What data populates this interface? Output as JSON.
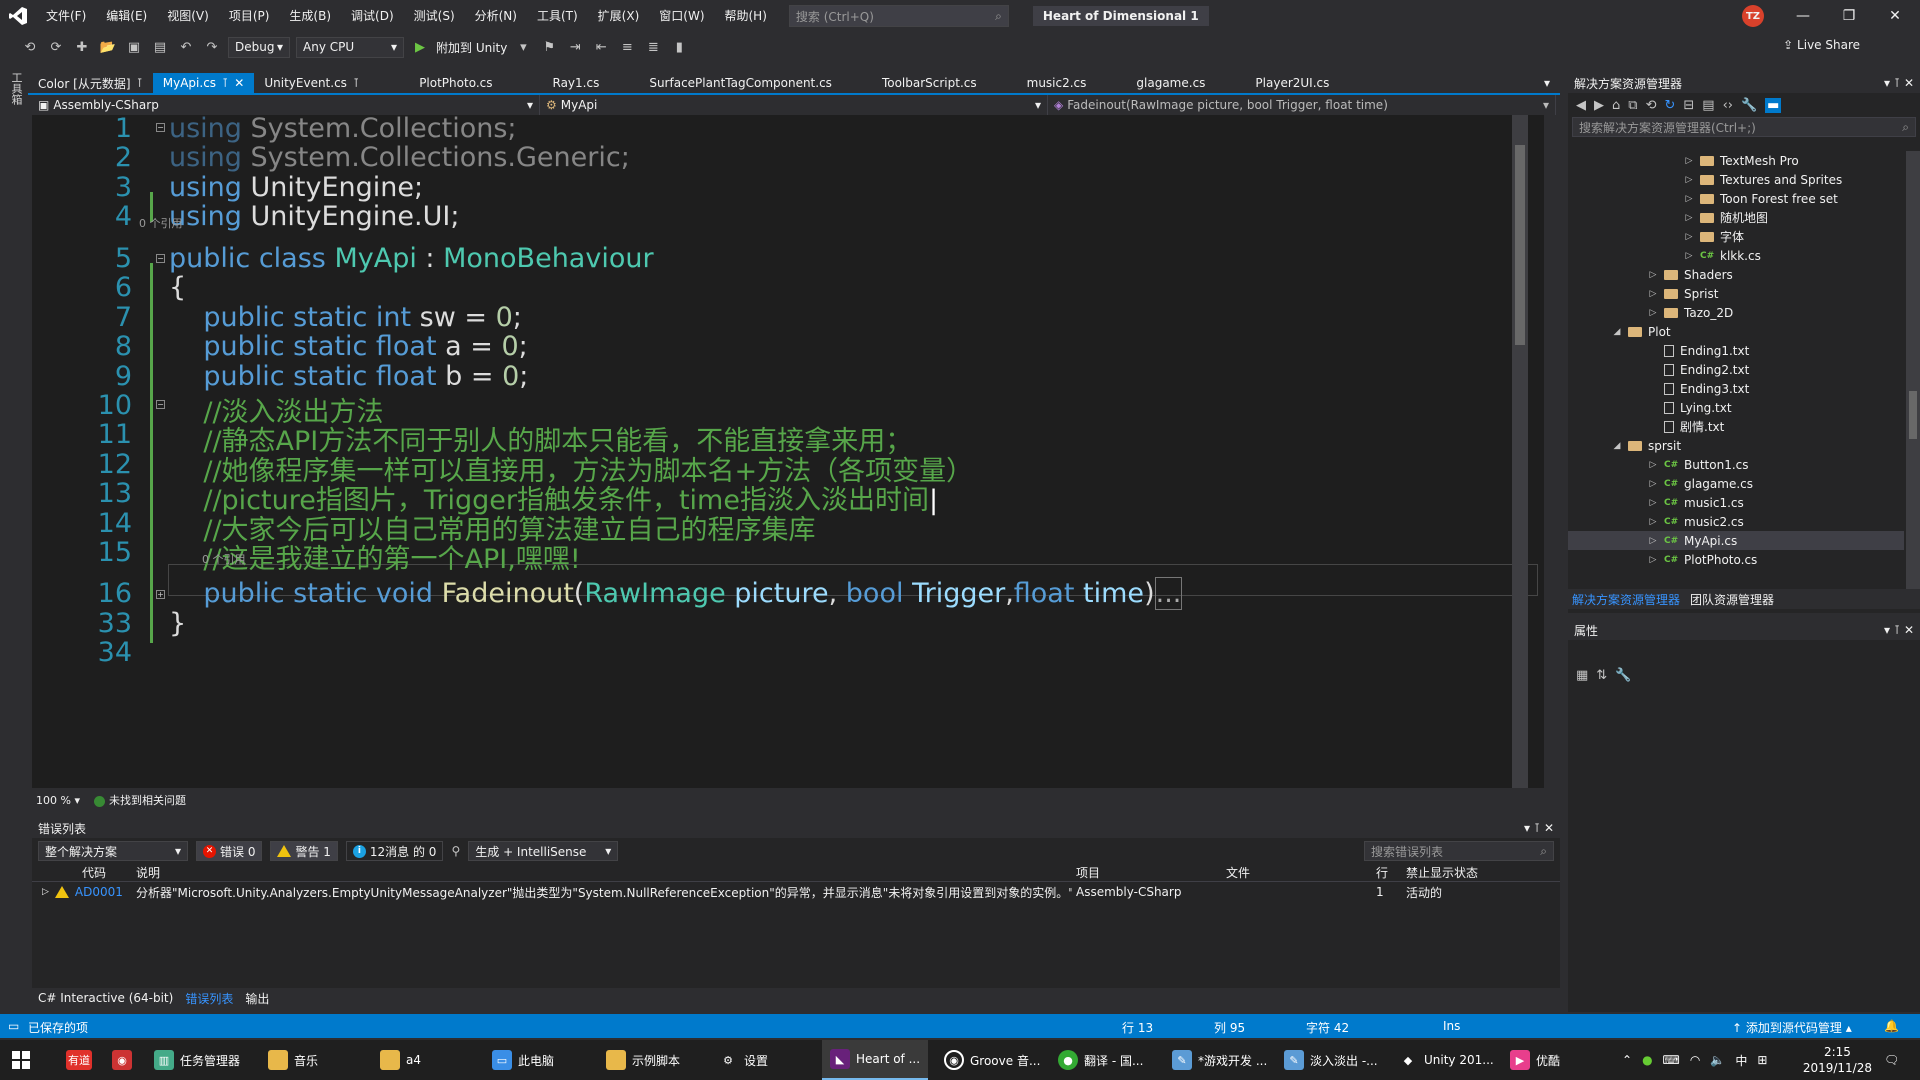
{
  "menu": [
    "文件(F)",
    "编辑(E)",
    "视图(V)",
    "项目(P)",
    "生成(B)",
    "调试(D)",
    "测试(S)",
    "分析(N)",
    "工具(T)",
    "扩展(X)",
    "窗口(W)",
    "帮助(H)"
  ],
  "quick_search_placeholder": "搜索 (Ctrl+Q)",
  "solution_name": "Heart of Dimensional 1",
  "user_initials": "TZ",
  "toolbar": {
    "config": "Debug",
    "platform": "Any CPU",
    "attach": "附加到 Unity",
    "live_share": "Live Share"
  },
  "toolbox_label": "工具箱",
  "tabs": [
    "Color [从元数据]",
    "MyApi.cs",
    "UnityEvent.cs",
    "PlotPhoto.cs",
    "Ray1.cs",
    "SurfacePlantTagComponent.cs",
    "ToolbarScript.cs",
    "music2.cs",
    "glagame.cs",
    "Player2UI.cs"
  ],
  "active_tab": "MyApi.cs",
  "nav": {
    "project": "Assembly-CSharp",
    "class": "MyApi",
    "member": "Fadeinout(RawImage picture, bool Trigger, float time)"
  },
  "code": {
    "line_numbers": [
      "1",
      "2",
      "3",
      "4",
      "5",
      "6",
      "7",
      "8",
      "9",
      "10",
      "11",
      "12",
      "13",
      "14",
      "15",
      "16",
      "33",
      "34"
    ],
    "ref_hint": "0 个引用",
    "l1_ns": "System.Collections;",
    "l2_ns": "System.Collections.Generic;",
    "l3_ns": "UnityEngine;",
    "l4_ns": "UnityEngine.UI;",
    "using_kw": "using",
    "class_decl": "public class",
    "class_name": "MyApi",
    "base_class": "MonoBehaviour",
    "c10": "//淡入淡出方法",
    "c11": "//静态API方法不同于别人的脚本只能看，不能直接拿来用；",
    "c12": "//她像程序集一样可以直接用，方法为脚本名+方法（各项变量）",
    "c13": "//picture指图片，Trigger指触发条件，time指淡入淡出时间",
    "c14": "//大家今后可以自己常用的算法建立自己的程序集库",
    "c15": "//这是我建立的第一个API,嘿嘿!",
    "method_name": "Fadeinout",
    "param_type1": "RawImage",
    "param1": "picture",
    "param_type2": "bool",
    "param2": "Trigger",
    "param_type3": "float",
    "param3": "time"
  },
  "editor_status": {
    "zoom": "100 %",
    "issues": "未找到相关问题"
  },
  "error_list": {
    "title": "错误列表",
    "scope": "整个解决方案",
    "errors": "错误 0",
    "warnings": "警告 1",
    "messages": "12消息 的 0",
    "build_filter": "生成 + IntelliSense",
    "search_placeholder": "搜索错误列表",
    "columns": [
      "代码",
      "说明",
      "项目",
      "文件",
      "行",
      "禁止显示状态"
    ],
    "rows": [
      {
        "code": "AD0001",
        "desc": "分析器\"Microsoft.Unity.Analyzers.EmptyUnityMessageAnalyzer\"抛出类型为\"System.NullReferenceException\"的异常，并显示消息\"未将对象引用设置到对象的实例。\"。",
        "project": "Assembly-CSharp",
        "file": "",
        "line": "1",
        "state": "活动的"
      }
    ]
  },
  "bottom_tabs": [
    "C# Interactive (64-bit)",
    "错误列表",
    "输出"
  ],
  "solution_explorer": {
    "title": "解决方案资源管理器",
    "search_placeholder": "搜索解决方案资源管理器(Ctrl+;)",
    "items": [
      {
        "label": "TextMesh Pro",
        "kind": "folder",
        "depth": 3
      },
      {
        "label": "Textures and Sprites",
        "kind": "folder",
        "depth": 3
      },
      {
        "label": "Toon Forest free set",
        "kind": "folder",
        "depth": 3
      },
      {
        "label": "随机地图",
        "kind": "folder",
        "depth": 3
      },
      {
        "label": "字体",
        "kind": "folder",
        "depth": 3
      },
      {
        "label": "klkk.cs",
        "kind": "cs",
        "depth": 3
      },
      {
        "label": "Shaders",
        "kind": "folder",
        "depth": 2
      },
      {
        "label": "Sprist",
        "kind": "folder",
        "depth": 2
      },
      {
        "label": "Tazo_2D",
        "kind": "folder",
        "depth": 2
      },
      {
        "label": "Plot",
        "kind": "folder-open",
        "depth": 1
      },
      {
        "label": "Ending1.txt",
        "kind": "file",
        "depth": 2
      },
      {
        "label": "Ending2.txt",
        "kind": "file",
        "depth": 2
      },
      {
        "label": "Ending3.txt",
        "kind": "file",
        "depth": 2
      },
      {
        "label": "Lying.txt",
        "kind": "file",
        "depth": 2
      },
      {
        "label": "剧情.txt",
        "kind": "file",
        "depth": 2
      },
      {
        "label": "sprsit",
        "kind": "folder-open",
        "depth": 1
      },
      {
        "label": "Button1.cs",
        "kind": "cs",
        "depth": 2
      },
      {
        "label": "glagame.cs",
        "kind": "cs",
        "depth": 2
      },
      {
        "label": "music1.cs",
        "kind": "cs",
        "depth": 2
      },
      {
        "label": "music2.cs",
        "kind": "cs",
        "depth": 2
      },
      {
        "label": "MyApi.cs",
        "kind": "cs",
        "depth": 2
      },
      {
        "label": "PlotPhoto.cs",
        "kind": "cs",
        "depth": 2
      },
      {
        "label": "Ray1.cs",
        "kind": "cs",
        "depth": 2
      }
    ],
    "selected": "MyApi.cs",
    "bottom_tabs": [
      "解决方案资源管理器",
      "团队资源管理器"
    ]
  },
  "properties": {
    "title": "属性"
  },
  "statusbar": {
    "saved": "已保存的项",
    "line": "行 13",
    "col": "列 95",
    "char": "字符 42",
    "mode": "Ins",
    "source_control": "添加到源代码管理"
  },
  "taskbar": {
    "apps": [
      "有道",
      "",
      "任务管理器",
      "音乐",
      "a4",
      "此电脑",
      "示例脚本",
      "设置",
      "Heart of ...",
      "Groove 音...",
      "翻译 - 国...",
      "*游戏开发 ...",
      "淡入淡出 -...",
      "Unity 201...",
      "优酷"
    ],
    "active_app": "Heart of ...",
    "ime": "中",
    "time": "2:15",
    "date": "2019/11/28"
  },
  "colors": {
    "accent": "#007acc",
    "keyword": "#569cd6",
    "type": "#4ec9b0",
    "comment": "#57a64a",
    "number": "#b5cea8",
    "line_number": "#2b91af"
  }
}
